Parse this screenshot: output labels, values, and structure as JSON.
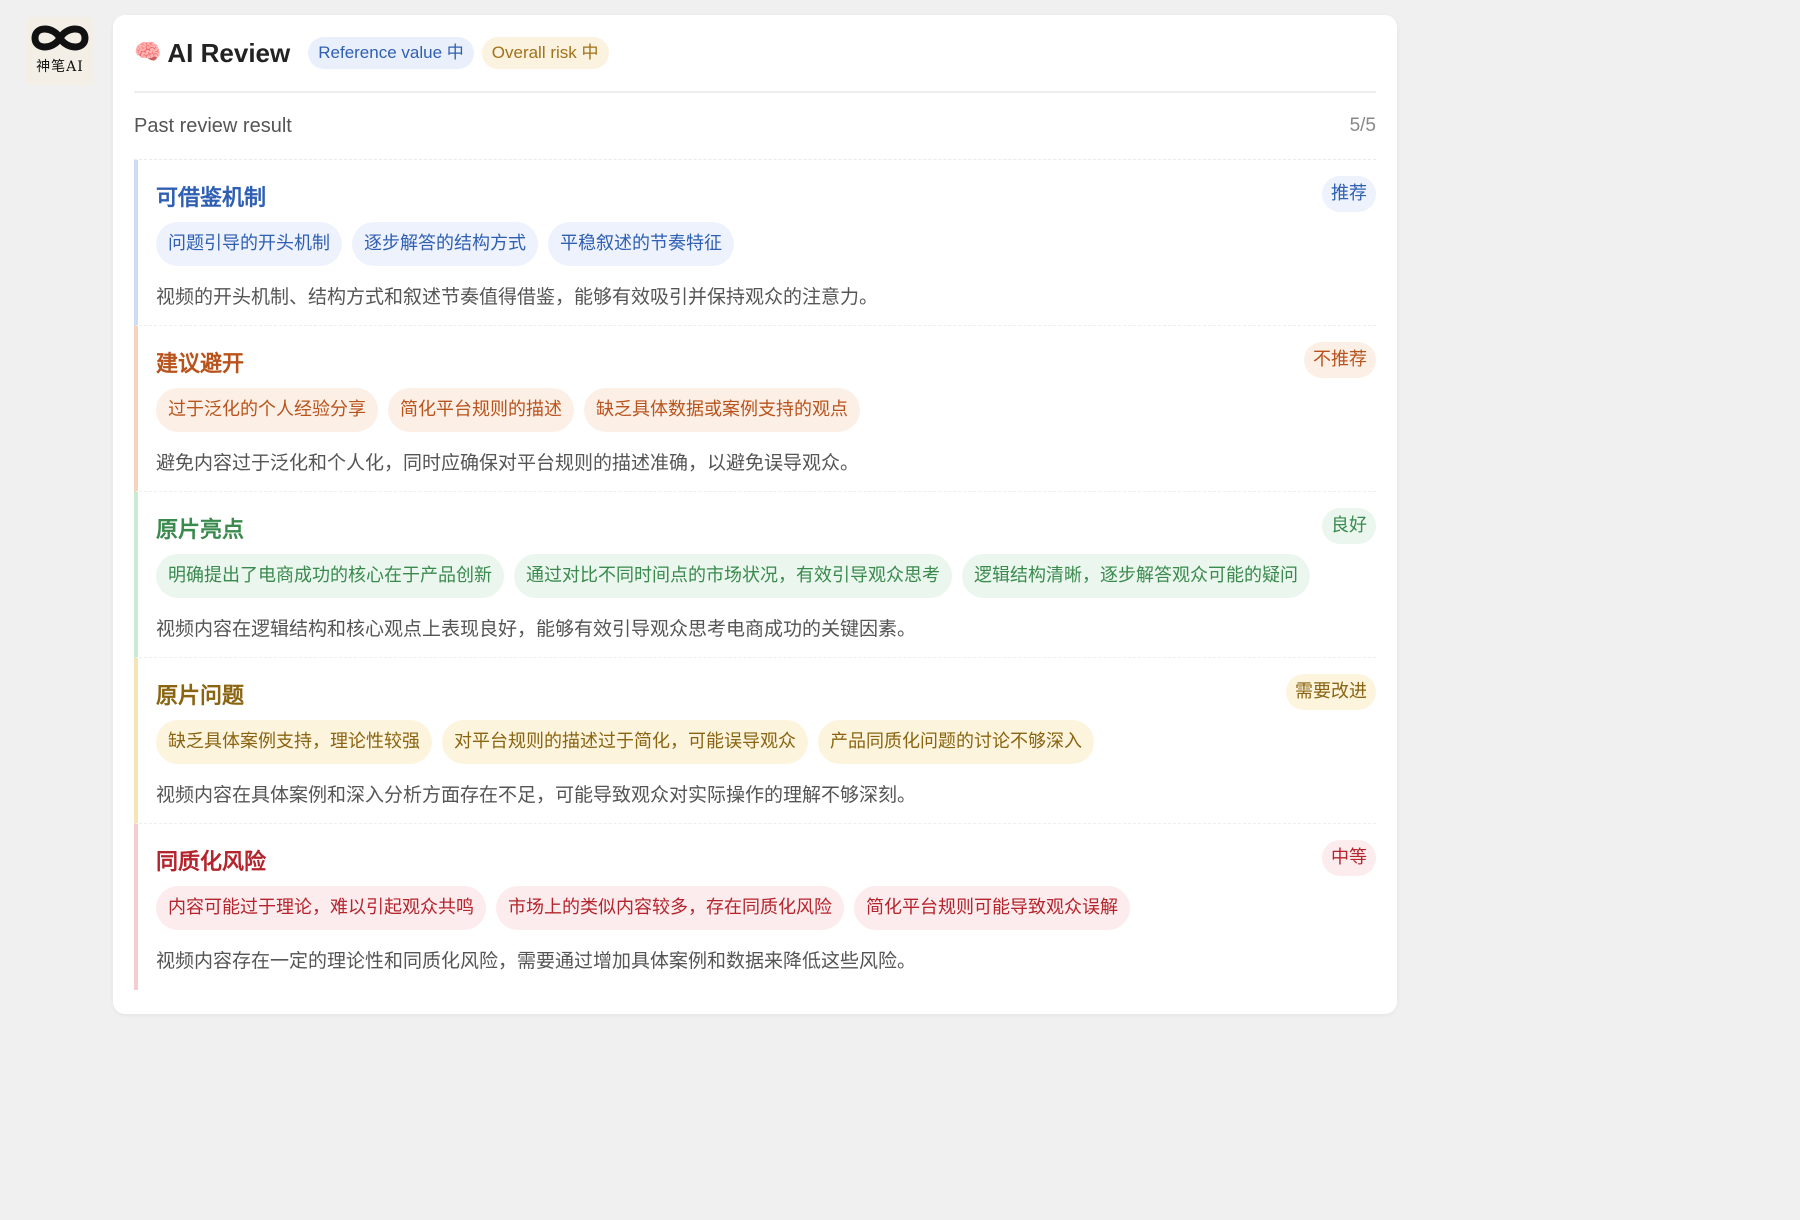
{
  "logo": {
    "text": "神笔AI"
  },
  "header": {
    "title": "AI Review",
    "reference_badge": "Reference value 中",
    "risk_badge": "Overall risk 中"
  },
  "subheader": {
    "label": "Past review result",
    "count": "5/5"
  },
  "sections": [
    {
      "title": "可借鉴机制",
      "badge": "推荐",
      "tags": [
        "问题引导的开头机制",
        "逐步解答的结构方式",
        "平稳叙述的节奏特征"
      ],
      "description": "视频的开头机制、结构方式和叙述节奏值得借鉴，能够有效吸引并保持观众的注意力。"
    },
    {
      "title": "建议避开",
      "badge": "不推荐",
      "tags": [
        "过于泛化的个人经验分享",
        "简化平台规则的描述",
        "缺乏具体数据或案例支持的观点"
      ],
      "description": "避免内容过于泛化和个人化，同时应确保对平台规则的描述准确，以避免误导观众。"
    },
    {
      "title": "原片亮点",
      "badge": "良好",
      "tags": [
        "明确提出了电商成功的核心在于产品创新",
        "通过对比不同时间点的市场状况，有效引导观众思考",
        "逻辑结构清晰，逐步解答观众可能的疑问"
      ],
      "description": "视频内容在逻辑结构和核心观点上表现良好，能够有效引导观众思考电商成功的关键因素。"
    },
    {
      "title": "原片问题",
      "badge": "需要改进",
      "tags": [
        "缺乏具体案例支持，理论性较强",
        "对平台规则的描述过于简化，可能误导观众",
        "产品同质化问题的讨论不够深入"
      ],
      "description": "视频内容在具体案例和深入分析方面存在不足，可能导致观众对实际操作的理解不够深刻。"
    },
    {
      "title": "同质化风险",
      "badge": "中等",
      "tags": [
        "内容可能过于理论，难以引起观众共鸣",
        "市场上的类似内容较多，存在同质化风险",
        "简化平台规则可能导致观众误解"
      ],
      "description": "视频内容存在一定的理论性和同质化风险，需要通过增加具体案例和数据来降低这些风险。"
    }
  ]
}
